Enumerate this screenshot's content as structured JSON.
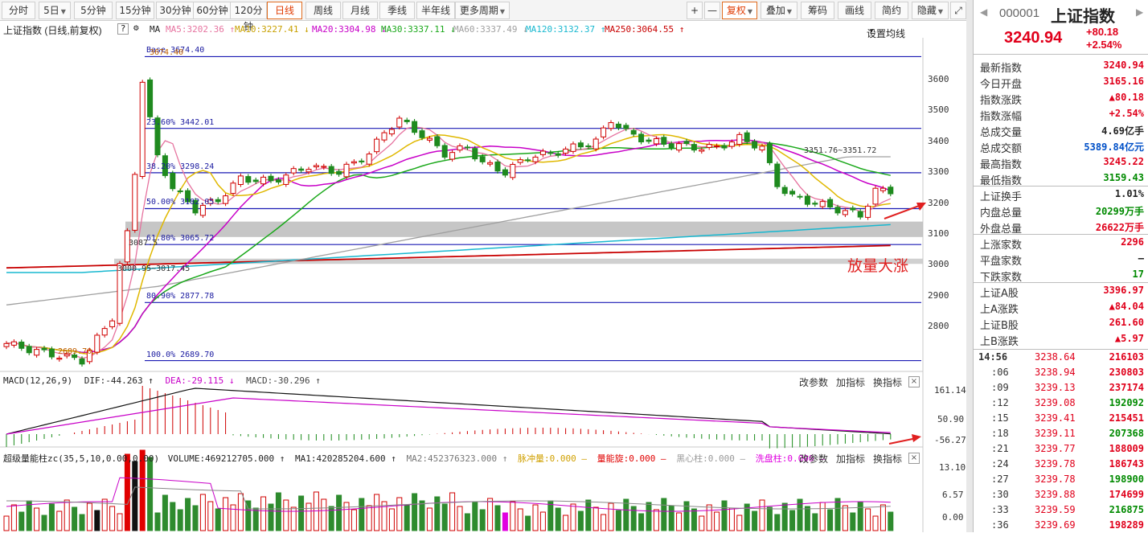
{
  "toolbar": {
    "periods": [
      "分时",
      "5日",
      "5分钟",
      "15分钟",
      "30分钟",
      "60分钟",
      "120分钟",
      "日线",
      "周线",
      "月线",
      "季线",
      "半年线",
      "更多周期"
    ],
    "active_period": "日线",
    "zoom_plus": "+",
    "zoom_minus": "—",
    "fq": "复权",
    "overlay": "叠加",
    "chips": "筹码",
    "draw": "画线",
    "simple": "简约",
    "hide": "隐藏"
  },
  "legend": {
    "title": "上证指数 (日线,前复权)",
    "ma": "MA",
    "ma5": "MA5:3202.36 ↑",
    "ma10": "MA10:3227.41 ↓",
    "ma20": "MA20:3304.98 ↓",
    "ma30": "MA30:3337.11 ↓",
    "ma60": "MA60:3337.49 ↓",
    "ma120": "MA120:3132.37 ↑",
    "ma250": "MA250:3064.55 ↑",
    "settings": "设置均线",
    "colors": {
      "ma5": "#e6739f",
      "ma10": "#e0b800",
      "ma20": "#c800c8",
      "ma30": "#1aa81a",
      "ma60": "#a0a0a0",
      "ma120": "#18b8d0",
      "ma250": "#c80000"
    }
  },
  "fib": {
    "lines": [
      {
        "label": "Base  3674.40",
        "price": 3674.4
      },
      {
        "label": "23.60% 3442.01",
        "price": 3442.01
      },
      {
        "label": "38.20% 3298.24",
        "price": 3298.24
      },
      {
        "label": "50.00% 3182.05",
        "price": 3182.05
      },
      {
        "label": "61.80% 3065.72",
        "price": 3065.72
      },
      {
        "label": "80.90% 2877.78",
        "price": 2877.78
      },
      {
        "label": "100.0% 2689.70",
        "price": 2689.7
      }
    ],
    "peak_label": "3674.40",
    "low_label": "2689.70",
    "mid_label": "3087.5",
    "note_3000": "3000.95~3017.45",
    "note_3351": "3351.76~3351.72"
  },
  "annotation": {
    "text": "放量大涨"
  },
  "price_axis": {
    "ticks": [
      3600,
      3500,
      3400,
      3300,
      3200,
      3100,
      3000,
      2900,
      2800
    ]
  },
  "macd": {
    "name": "MACD(12,26,9)",
    "dif": "DIF:-44.263 ↑",
    "dea": "DEA:-29.115 ↓",
    "macd": "MACD:-30.296 ↑",
    "btn1": "改参数",
    "btn2": "加指标",
    "btn3": "换指标",
    "close": "×",
    "axis": [
      "161.14",
      "50.90",
      "-56.27"
    ]
  },
  "vol": {
    "name": "超级量能柱zc(35,5,10,0.00,0.00)",
    "volume": "VOLUME:469212705.000 ↑",
    "ma1": "MA1:420285204.600 ↑",
    "ma2": "MA2:452376323.000 ↑",
    "pulse": "脉冲量:0.000 —",
    "rotate": "量能旋:0.000 —",
    "black": "黑心柱:0.000 —",
    "wash": "洗盘柱:0.000 —",
    "btn1": "改参数",
    "btn2": "加指标",
    "btn3": "换指标",
    "close": "×",
    "axis": [
      "13.10",
      "6.57",
      "0.00"
    ]
  },
  "quote": {
    "code": "000001",
    "name": "上证指数",
    "price": "3240.94",
    "change": "+80.18",
    "pct": "+2.54%",
    "rows1": [
      {
        "k": "最新指数",
        "v": "3240.94",
        "c": "red"
      },
      {
        "k": "今日开盘",
        "v": "3165.16",
        "c": "red"
      },
      {
        "k": "指数涨跌",
        "v": "▲80.18",
        "c": "red"
      },
      {
        "k": "指数涨幅",
        "v": "+2.54%",
        "c": "red"
      },
      {
        "k": "总成交量",
        "v": "4.69亿手",
        "c": "blk"
      },
      {
        "k": "总成交额",
        "v": "5389.84亿元",
        "c": "blue"
      },
      {
        "k": "最高指数",
        "v": "3245.22",
        "c": "red"
      },
      {
        "k": "最低指数",
        "v": "3159.43",
        "c": "green"
      }
    ],
    "rows2": [
      {
        "k": "上证换手",
        "v": "1.01%",
        "c": "blk"
      },
      {
        "k": "内盘总量",
        "v": "20299万手",
        "c": "green"
      },
      {
        "k": "外盘总量",
        "v": "26622万手",
        "c": "red"
      }
    ],
    "rows3": [
      {
        "k": "上涨家数",
        "v": "2296",
        "c": "red"
      },
      {
        "k": "平盘家数",
        "v": "—",
        "c": "blk"
      },
      {
        "k": "下跌家数",
        "v": "17",
        "c": "green"
      }
    ],
    "rows4": [
      {
        "k": "上证A股",
        "v": "3396.97",
        "c": "red"
      },
      {
        "k": "上A涨跌",
        "v": "▲84.04",
        "c": "red"
      },
      {
        "k": "上证B股",
        "v": "261.60",
        "c": "red"
      },
      {
        "k": "上B涨跌",
        "v": "▲5.97",
        "c": "red"
      }
    ],
    "ticks": [
      {
        "t": "14:56",
        "p": "3238.64",
        "v": "216103",
        "vc": "red"
      },
      {
        "t": ":06",
        "p": "3238.94",
        "v": "230803",
        "vc": "red"
      },
      {
        "t": ":09",
        "p": "3239.13",
        "v": "237174",
        "vc": "red"
      },
      {
        "t": ":12",
        "p": "3239.08",
        "v": "192092",
        "vc": "green"
      },
      {
        "t": ":15",
        "p": "3239.41",
        "v": "215451",
        "vc": "red"
      },
      {
        "t": ":18",
        "p": "3239.11",
        "v": "207368",
        "vc": "green"
      },
      {
        "t": ":21",
        "p": "3239.77",
        "v": "188009",
        "vc": "red"
      },
      {
        "t": ":24",
        "p": "3239.78",
        "v": "186743",
        "vc": "red"
      },
      {
        "t": ":27",
        "p": "3239.78",
        "v": "198900",
        "vc": "green"
      },
      {
        "t": ":30",
        "p": "3239.88",
        "v": "174699",
        "vc": "red"
      },
      {
        "t": ":33",
        "p": "3239.59",
        "v": "216875",
        "vc": "green"
      },
      {
        "t": ":36",
        "p": "3239.69",
        "v": "198289",
        "vc": "red"
      }
    ]
  }
}
